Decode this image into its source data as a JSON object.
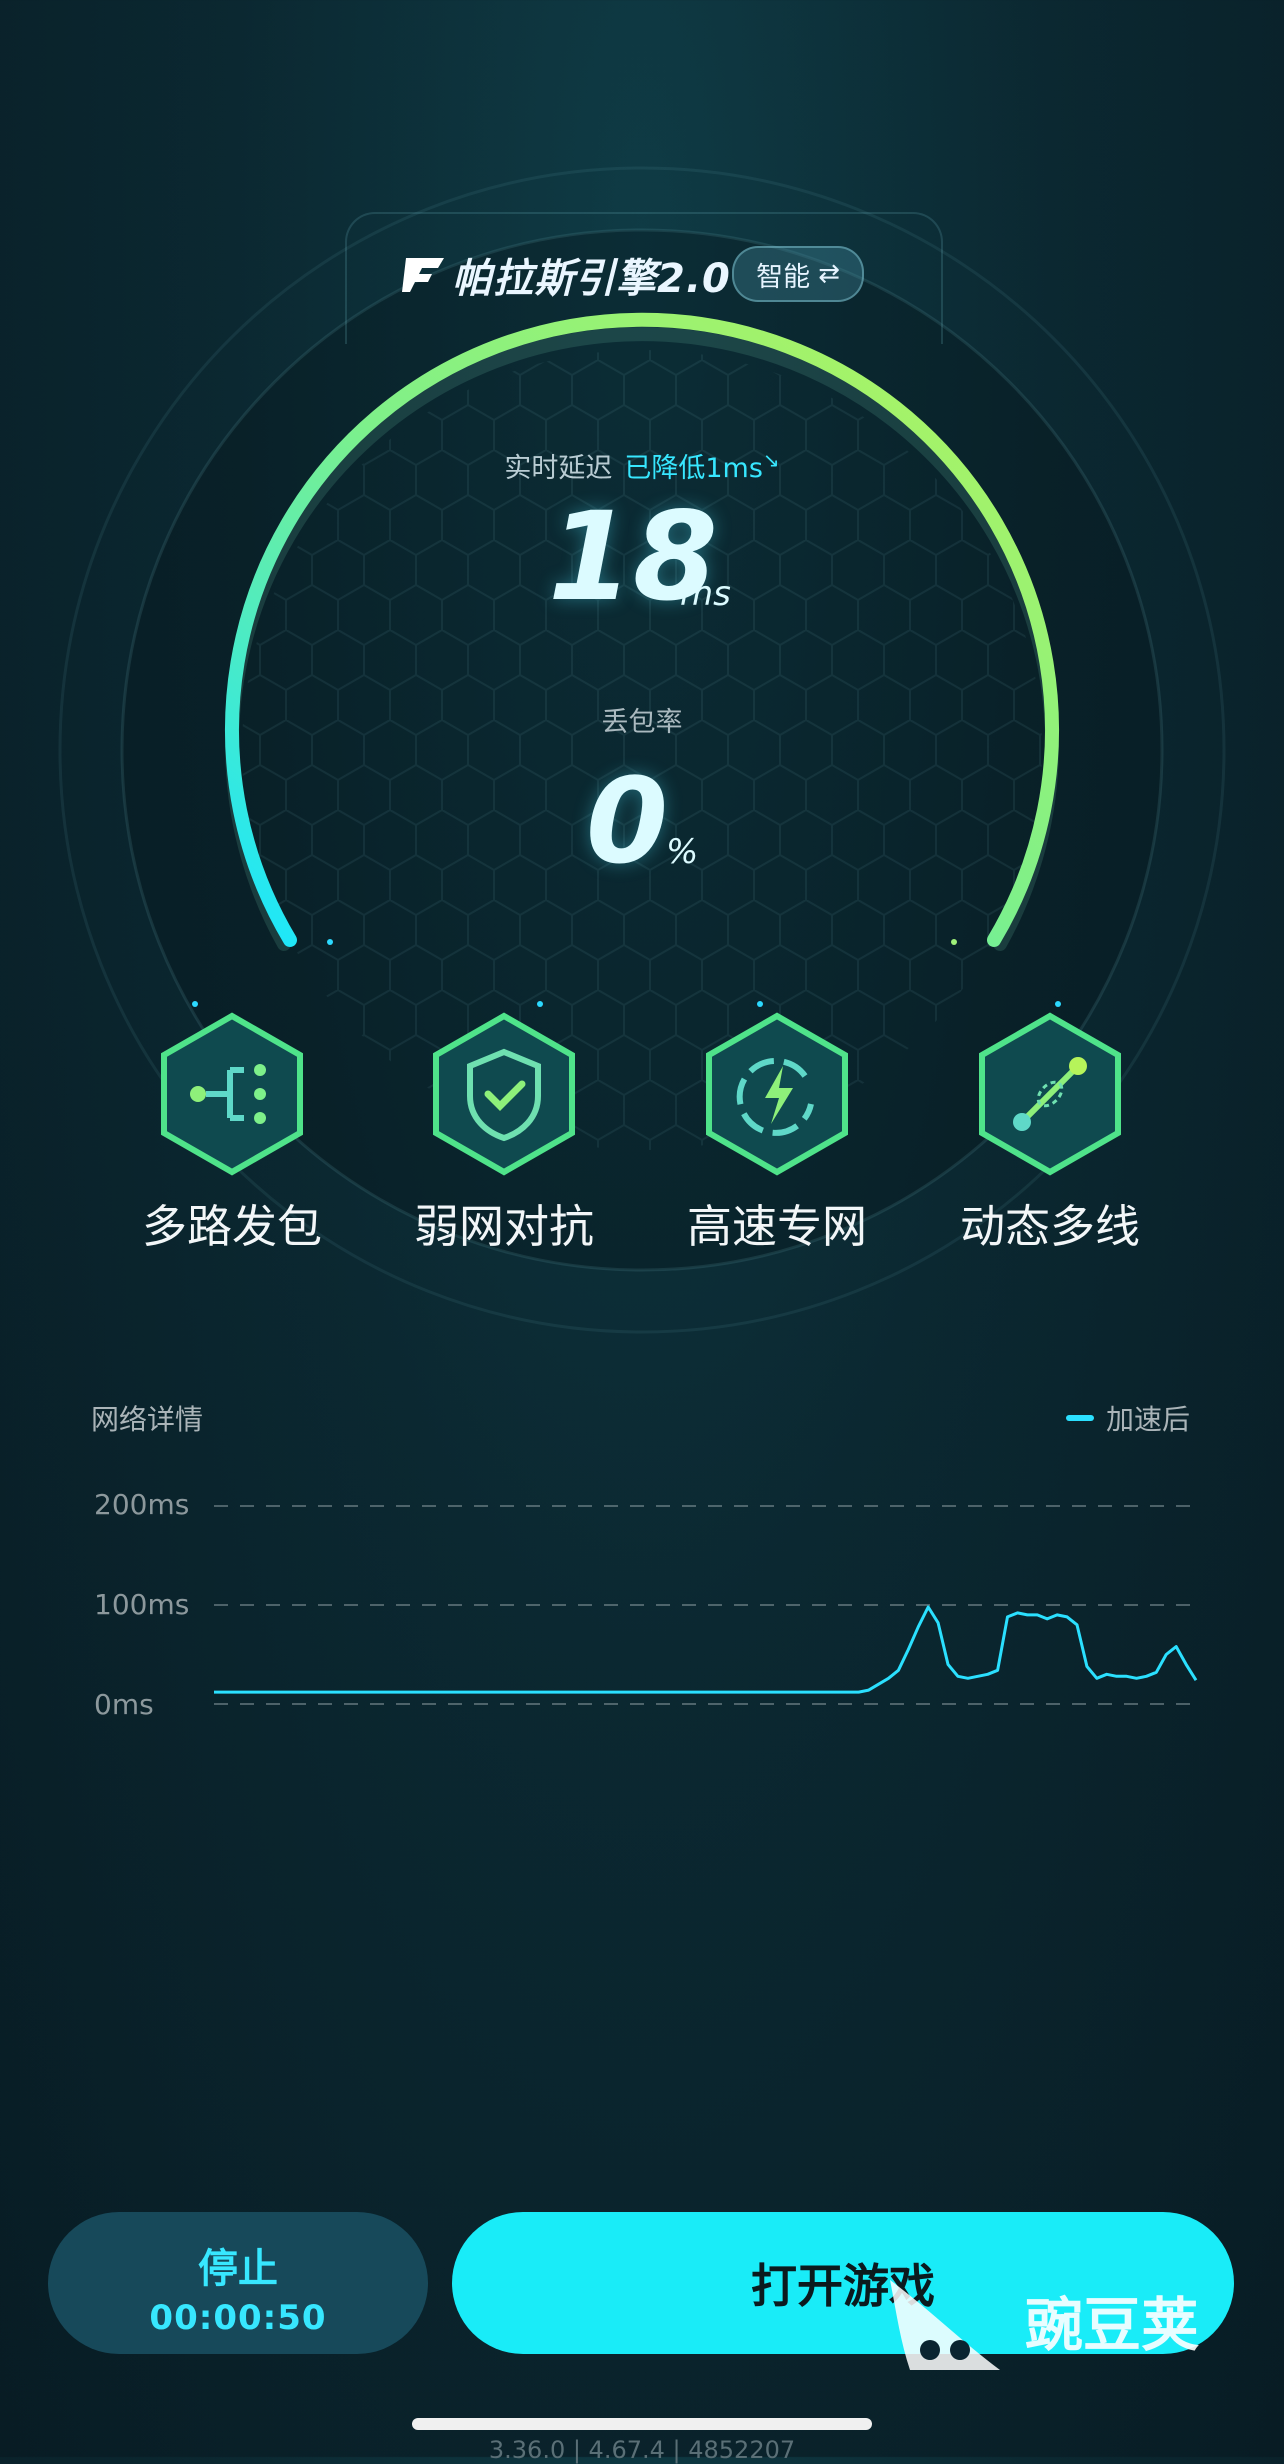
{
  "engine": {
    "title": "帕拉斯引擎2.0",
    "mode_chip": "智能",
    "mode_icon": "swap-arrows-icon"
  },
  "gauge": {
    "latency_label": "实时延迟",
    "latency_reduction": "已降低1ms",
    "latency_value": "18",
    "latency_unit": "ms",
    "loss_label": "丢包率",
    "loss_value": "0",
    "loss_unit": "%",
    "arc_color_start": "#19e6ff",
    "arc_color_end": "#b6f45a"
  },
  "features": [
    {
      "label": "多路发包",
      "icon": "multipath-icon"
    },
    {
      "label": "弱网对抗",
      "icon": "shield-check-icon"
    },
    {
      "label": "高速专网",
      "icon": "lightning-icon"
    },
    {
      "label": "动态多线",
      "icon": "link-line-icon"
    }
  ],
  "network": {
    "title": "网络详情",
    "legend": "加速后"
  },
  "chart_data": {
    "type": "line",
    "title": "",
    "xlabel": "",
    "ylabel": "",
    "ylim": [
      0,
      200
    ],
    "yticks": [
      "200ms",
      "100ms",
      "0ms"
    ],
    "grid": true,
    "legend_placement": "top-right",
    "series": [
      {
        "name": "加速后",
        "color": "#2be0ff",
        "values": [
          12,
          12,
          12,
          12,
          12,
          12,
          12,
          12,
          12,
          12,
          12,
          12,
          12,
          12,
          12,
          12,
          12,
          12,
          12,
          12,
          12,
          12,
          12,
          12,
          12,
          12,
          12,
          12,
          12,
          12,
          12,
          12,
          12,
          12,
          12,
          12,
          12,
          12,
          12,
          12,
          12,
          12,
          12,
          12,
          12,
          12,
          12,
          12,
          12,
          12,
          12,
          12,
          12,
          12,
          12,
          12,
          12,
          12,
          12,
          12,
          12,
          12,
          12,
          12,
          12,
          12,
          14,
          20,
          26,
          34,
          55,
          78,
          98,
          82,
          40,
          28,
          26,
          28,
          30,
          34,
          88,
          92,
          90,
          90,
          86,
          90,
          88,
          80,
          38,
          26,
          30,
          28,
          28,
          26,
          28,
          32,
          50,
          58,
          40,
          24
        ]
      }
    ]
  },
  "actions": {
    "stop_label": "停止",
    "stop_timer": "00:00:50",
    "open_game": "打开游戏"
  },
  "watermark": "豌豆荚",
  "version": "3.36.0 | 4.67.4 | 4852207"
}
